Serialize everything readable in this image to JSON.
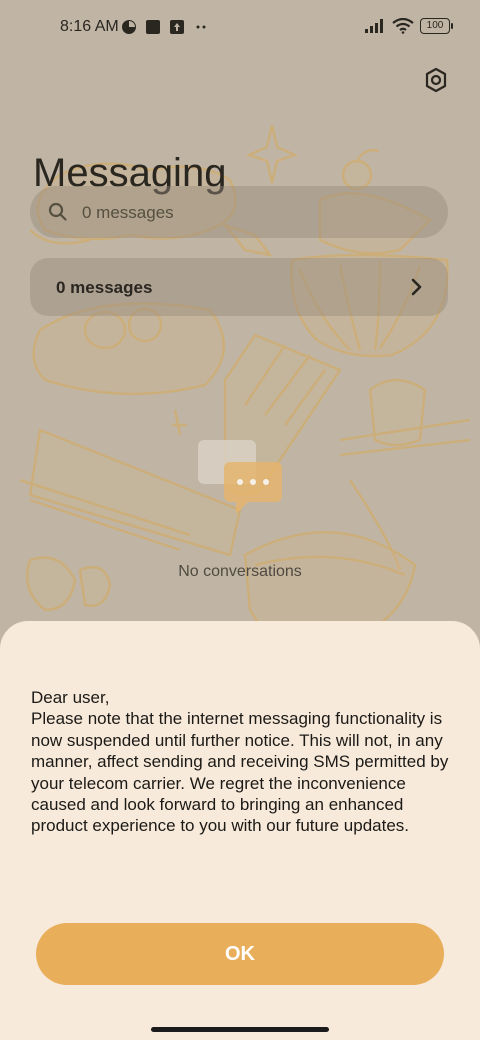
{
  "status_bar": {
    "time": "8:16 AM",
    "battery": "100",
    "icons": [
      "data-saver-icon",
      "square-icon",
      "upload-icon",
      "more-dots-icon",
      "signal-icon",
      "wifi-icon"
    ]
  },
  "header": {
    "title": "Messaging",
    "settings_icon": "gear-icon"
  },
  "search": {
    "placeholder": "0 messages",
    "icon": "search-icon"
  },
  "messages_row": {
    "label": "0 messages",
    "icon": "chevron-right-icon"
  },
  "empty_state": {
    "text": "No conversations",
    "icon": "chat-bubbles-icon"
  },
  "dialog": {
    "message": "Dear user,\nPlease note that the internet messaging functionality is now suspended until further notice. This will not, in any manner, affect sending and receiving SMS permitted by your telecom carrier. We regret the inconvenience caused and look forward to bringing an enhanced product experience to you with our future updates.",
    "ok_label": "OK"
  },
  "colors": {
    "background_dim": "#c0b5a5",
    "sheet": "#f7eadb",
    "accent": "#e9ae5a"
  }
}
